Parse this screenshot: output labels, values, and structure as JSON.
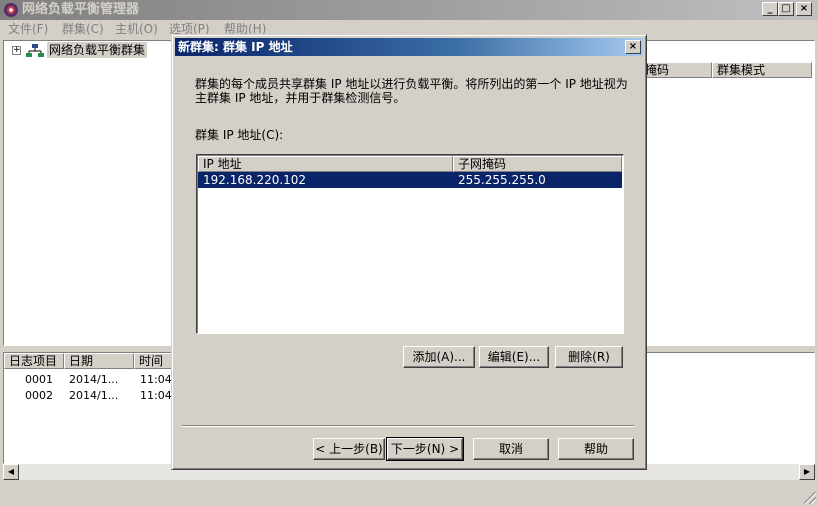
{
  "window": {
    "title": "网络负载平衡管理器",
    "minimize": "_",
    "maximize": "□",
    "close": "×"
  },
  "menu": [
    {
      "label": "文件(F)"
    },
    {
      "label": "群集(C)"
    },
    {
      "label": "主机(O)"
    },
    {
      "label": "选项(P)"
    },
    {
      "label": "帮助(H)"
    }
  ],
  "tree": {
    "root_label": "网络负载平衡群集",
    "expander": "+"
  },
  "list": {
    "columns": [
      "子网掩码",
      "群集模式"
    ]
  },
  "log": {
    "columns": [
      "日志项目",
      "日期",
      "时间"
    ],
    "rows": [
      {
        "id": "0001",
        "date": "2014/1...",
        "time": "11:04"
      },
      {
        "id": "0002",
        "date": "2014/1...",
        "time": "11:04"
      }
    ]
  },
  "dialog": {
    "title": "新群集: 群集 IP 地址",
    "close": "×",
    "description": "群集的每个成员共享群集 IP 地址以进行负载平衡。将所列出的第一个 IP 地址视为主群集 IP 地址，并用于群集检测信号。",
    "ip_label": "群集 IP 地址(C):",
    "ip_table": {
      "columns": [
        "IP 地址",
        "子网掩码"
      ],
      "rows": [
        {
          "ip": "192.168.220.102",
          "mask": "255.255.255.0"
        }
      ]
    },
    "buttons": {
      "add": "添加(A)...",
      "edit": "编辑(E)...",
      "remove": "删除(R)",
      "back": "< 上一步(B)",
      "next": "下一步(N) >",
      "cancel": "取消",
      "help": "帮助"
    }
  }
}
